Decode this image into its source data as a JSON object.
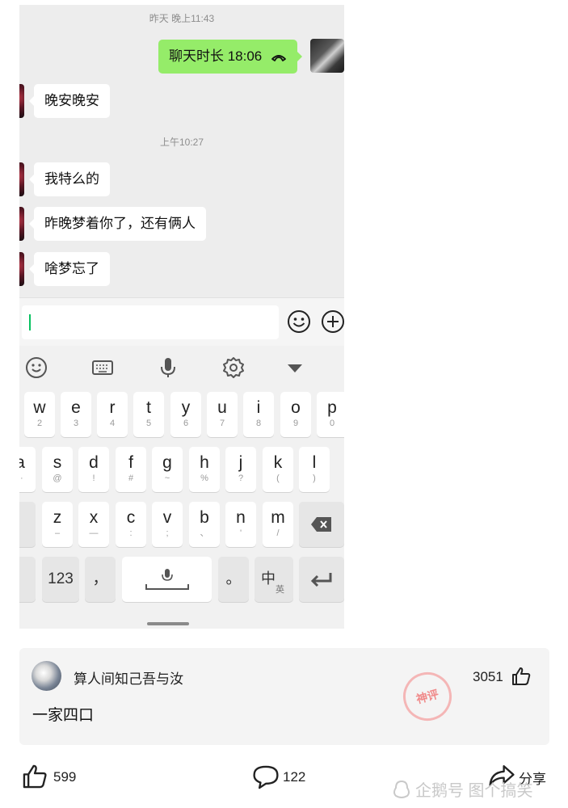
{
  "chat": {
    "timestamps": [
      "昨天 晚上11:43",
      "上午10:27"
    ],
    "sent_call": {
      "label": "聊天时长 18:06"
    },
    "messages": [
      "晚安晚安",
      "我特么的",
      "昨晚梦着你了，还有俩人",
      "啥梦忘了"
    ],
    "accent_color": "#95ec69"
  },
  "keyboard": {
    "row1": [
      {
        "k": "w",
        "s": "2"
      },
      {
        "k": "e",
        "s": "3"
      },
      {
        "k": "r",
        "s": "4"
      },
      {
        "k": "t",
        "s": "5"
      },
      {
        "k": "y",
        "s": "6"
      },
      {
        "k": "u",
        "s": "7"
      },
      {
        "k": "i",
        "s": "8"
      },
      {
        "k": "o",
        "s": "9"
      },
      {
        "k": "p",
        "s": "0"
      }
    ],
    "row2": [
      {
        "k": "a",
        "s": "··"
      },
      {
        "k": "s",
        "s": "@"
      },
      {
        "k": "d",
        "s": "!"
      },
      {
        "k": "f",
        "s": "#"
      },
      {
        "k": "g",
        "s": "~"
      },
      {
        "k": "h",
        "s": "%"
      },
      {
        "k": "j",
        "s": "?"
      },
      {
        "k": "k",
        "s": "("
      },
      {
        "k": "l",
        "s": ")"
      }
    ],
    "row3": [
      {
        "k": "z",
        "s": "–"
      },
      {
        "k": "x",
        "s": "—"
      },
      {
        "k": "c",
        "s": ":"
      },
      {
        "k": "v",
        "s": ";"
      },
      {
        "k": "b",
        "s": "、"
      },
      {
        "k": "n",
        "s": "'"
      },
      {
        "k": "m",
        "s": "/"
      }
    ],
    "row4": {
      "num": "123",
      "comma": "，",
      "period": "。",
      "lang_main": "中",
      "lang_sub": "英"
    },
    "toolbar_icons": [
      "emoji-icon",
      "keyboard-icon",
      "mic-icon",
      "settings-icon",
      "collapse-icon"
    ]
  },
  "comment": {
    "username": "算人间知己吾与汝",
    "likes": "3051",
    "text": "一家四口",
    "stamp_text": "神评"
  },
  "actions": {
    "likes": "599",
    "comments": "122",
    "share": "分享"
  },
  "watermark": "企鹅号 图个搞笑"
}
